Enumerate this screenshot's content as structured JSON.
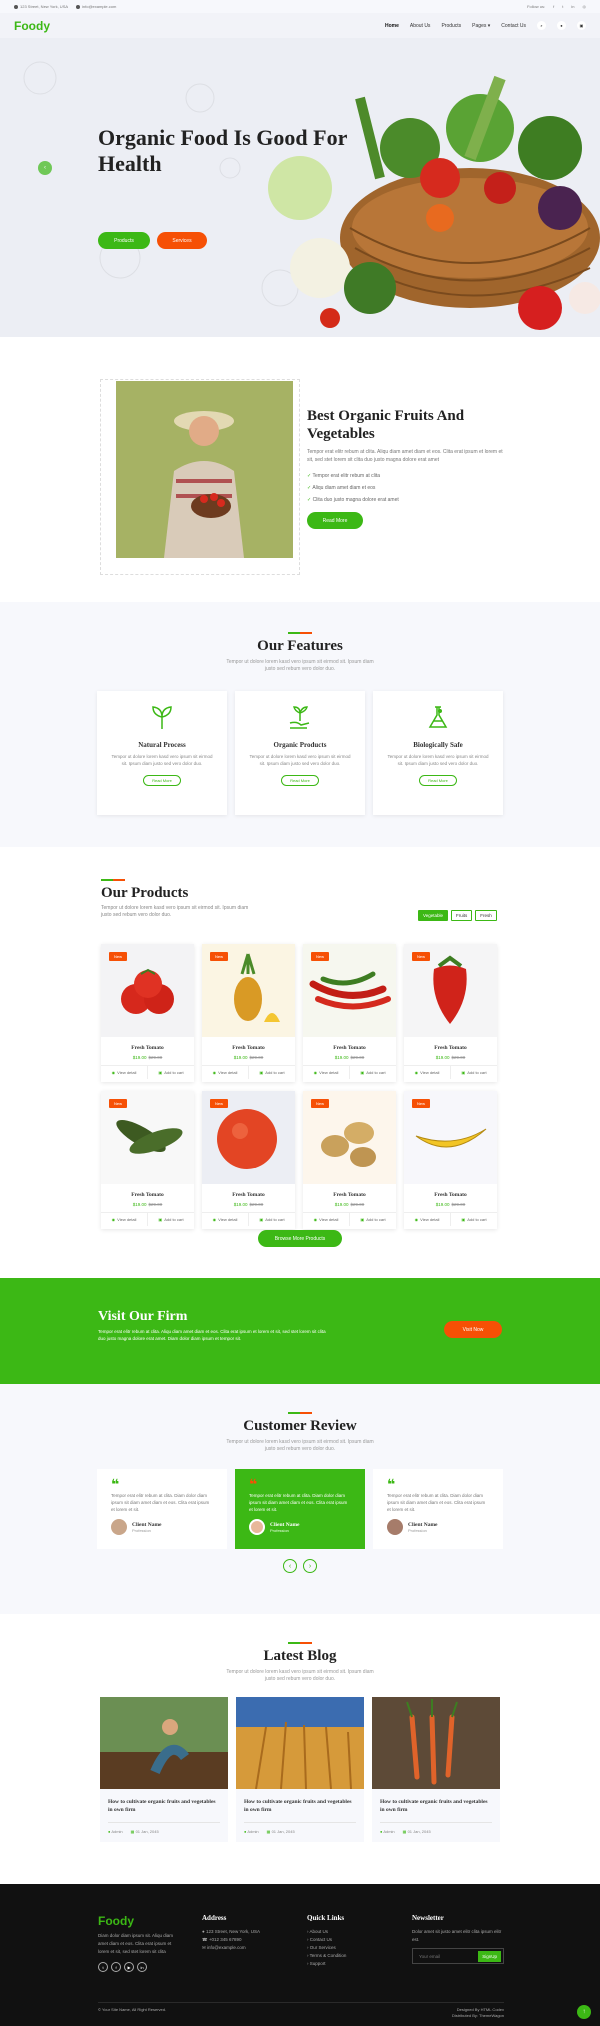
{
  "topbar": {
    "address": "123 Street, New York, USA",
    "email": "info@example.com",
    "follow": "Follow us:"
  },
  "nav": {
    "brand": "Foody",
    "items": [
      "Home",
      "About Us",
      "Products",
      "Pages",
      "Contact Us"
    ]
  },
  "hero": {
    "title": "Organic Food Is Good For Health",
    "btn_products": "Products",
    "btn_services": "Services"
  },
  "about": {
    "title": "Best Organic Fruits And Vegetables",
    "text": "Tempor erat elitr rebum at clita. Aliqu diam amet diam et eos. Clita erat ipsum et lorem et sit, sed stet lorem sit clita duo justo magna dolore erat amet",
    "checks": [
      "Tempor erat elitr rebum at clita",
      "Aliqu diam amet diam et eos",
      "Clita duo justo magna dolore erat amet"
    ],
    "btn": "Read More"
  },
  "features": {
    "title": "Our Features",
    "sub": "Tempor ut dolore lorem kasd vero ipsum sit eirmod sit. Ipsum diam justo sed rebum vero dolor duo.",
    "items": [
      {
        "title": "Natural Process",
        "text": "Tempor ut dolore lorem kasd vero ipsum sit eirmod sit. Ipsum diam justo sed vero dolor duo.",
        "btn": "Read More"
      },
      {
        "title": "Organic Products",
        "text": "Tempor ut dolore lorem kasd vero ipsum sit eirmod sit. Ipsum diam justo sed vero dolor duo.",
        "btn": "Read More"
      },
      {
        "title": "Biologically Safe",
        "text": "Tempor ut dolore lorem kasd vero ipsum sit eirmod sit. Ipsum diam justo sed vero dolor duo.",
        "btn": "Read More"
      }
    ]
  },
  "products": {
    "title": "Our Products",
    "sub": "Tempor ut dolore lorem kasd vero ipsum sit eirmod sit. Ipsum diam justo sed rebum vero dolor duo.",
    "tabs": [
      "Vegetable",
      "Fruits",
      "Fresh"
    ],
    "badge": "New",
    "view": "View detail",
    "cart": "Add to cart",
    "more": "Browse More Products",
    "items": [
      {
        "name": "Fresh Tomato",
        "price": "$19.00",
        "old": "$29.00"
      },
      {
        "name": "Fresh Tomato",
        "price": "$19.00",
        "old": "$29.00"
      },
      {
        "name": "Fresh Tomato",
        "price": "$19.00",
        "old": "$29.00"
      },
      {
        "name": "Fresh Tomato",
        "price": "$19.00",
        "old": "$29.00"
      },
      {
        "name": "Fresh Tomato",
        "price": "$19.00",
        "old": "$29.00"
      },
      {
        "name": "Fresh Tomato",
        "price": "$19.00",
        "old": "$29.00"
      },
      {
        "name": "Fresh Tomato",
        "price": "$19.00",
        "old": "$29.00"
      },
      {
        "name": "Fresh Tomato",
        "price": "$19.00",
        "old": "$29.00"
      }
    ]
  },
  "firm": {
    "title": "Visit Our Firm",
    "text": "Tempor erat elitr rebum at clita. Aliqu diam amet diam et eos. Clita erat ipsum et lorem et sit, sed stet lorem sit clita duo justo magna dolore erat amet. Diam dolor diam ipsum et tempor sit.",
    "btn": "Visit Now"
  },
  "review": {
    "title": "Customer Review",
    "sub": "Tempor ut dolore lorem kasd vero ipsum sit eirmod sit. Ipsum diam justo sed rebum vero dolor duo.",
    "items": [
      {
        "text": "Tempor erat elitr rebum at clita. Diam dolor diam ipsum sit diam amet diam et eos. Clita erat ipsum et lorem et sit.",
        "name": "Client Name",
        "role": "Profession"
      },
      {
        "text": "Tempor erat elitr rebum at clita. Diam dolor diam ipsum sit diam amet diam et eos. Clita erat ipsum et lorem et sit.",
        "name": "Client Name",
        "role": "Profession"
      },
      {
        "text": "Tempor erat elitr rebum at clita. Diam dolor diam ipsum sit diam amet diam et eos. Clita erat ipsum et lorem et sit.",
        "name": "Client Name",
        "role": "Profession"
      }
    ]
  },
  "blog": {
    "title": "Latest Blog",
    "sub": "Tempor ut dolore lorem kasd vero ipsum sit eirmod sit. Ipsum diam justo sed rebum vero dolor duo.",
    "items": [
      {
        "title": "How to cultivate organic fruits and vegetables in own firm",
        "author": "Admin",
        "date": "01 Jan, 2045"
      },
      {
        "title": "How to cultivate organic fruits and vegetables in own firm",
        "author": "Admin",
        "date": "01 Jan, 2045"
      },
      {
        "title": "How to cultivate organic fruits and vegetables in own firm",
        "author": "Admin",
        "date": "01 Jan, 2045"
      }
    ]
  },
  "footer": {
    "brand": "Foody",
    "about": "Diam dolor diam ipsum sit. Aliqu diam amet diam et eos. Clita erat ipsum et lorem et sit, sed stet lorem sit clita",
    "address_h": "Address",
    "address": "123 Street, New York, USA",
    "phone": "+012 345 67890",
    "email": "info@example.com",
    "links_h": "Quick Links",
    "links": [
      "About Us",
      "Contact Us",
      "Our Services",
      "Terms & Condition",
      "Support"
    ],
    "news_h": "Newsletter",
    "news_text": "Dolor amet sit justo amet elitr clita ipsum elitr est.",
    "news_ph": "Your email",
    "news_btn": "SignUp",
    "copy": "© Your Site Name, All Right Reserved.",
    "designed": "Designed By HTML Codex",
    "distributed": "Distributed By: ThemeWagon"
  },
  "colors": {
    "primary": "#3cb815",
    "secondary": "#f65005"
  }
}
